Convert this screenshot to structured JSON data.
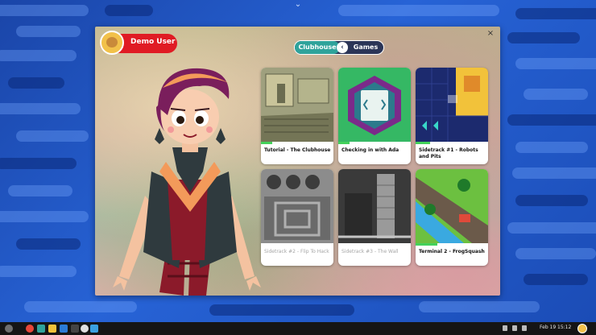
{
  "user": {
    "name": "Demo User"
  },
  "toggle": {
    "left_label": "Clubhouse",
    "right_label": "Games",
    "knob_glyph": "‹"
  },
  "window": {
    "close_glyph": "×"
  },
  "cards": [
    {
      "title": "Tutorial - The Clubhouse",
      "locked": false,
      "progress": 0.15,
      "theme": "clubhouse"
    },
    {
      "title": "Checking in with Ada",
      "locked": false,
      "progress": 0.15,
      "theme": "ada"
    },
    {
      "title": "Sidetrack #1 - Robots and Pits",
      "locked": false,
      "progress": 0.2,
      "theme": "robots"
    },
    {
      "title": "Sidetrack #2 - Flip To Hack",
      "locked": true,
      "progress": 0.0,
      "theme": "flip"
    },
    {
      "title": "Sidetrack #3 - The Wall",
      "locked": true,
      "progress": 0.0,
      "theme": "wall"
    },
    {
      "title": "Terminal 2 - FrogSquash",
      "locked": false,
      "progress": 0.3,
      "theme": "frog"
    }
  ],
  "taskbar": {
    "date": "Feb 19",
    "time": "15:12",
    "app_icons": [
      "apps-icon",
      "chromium-icon",
      "clubhouse-icon",
      "files-icon",
      "terminal-icon",
      "hack-icon",
      "settings-icon",
      "store-icon"
    ]
  },
  "colors": {
    "accent_red": "#e01b24",
    "toggle_teal": "#2fa39b",
    "progress_green": "#43d15a"
  }
}
